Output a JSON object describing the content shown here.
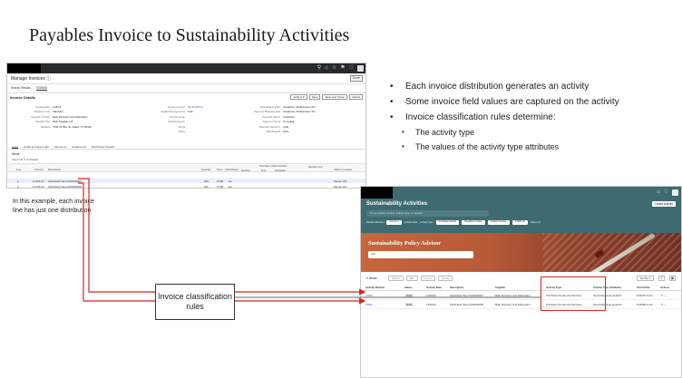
{
  "slide": {
    "title": "Payables Invoice to Sustainability Activities",
    "note": "In this example, each invoice line has just one distribution",
    "rules_box": "Invoice classification rules"
  },
  "bullets": {
    "level1": [
      "Each invoice distribution generates an activity",
      "Some invoice field values are captured on the activity",
      "Invoice classification rules determine:"
    ],
    "level2": [
      "The activity type",
      "The values of the activity type attributes"
    ]
  },
  "manage_invoices": {
    "title": "Manage Invoices ⓘ",
    "done": "Done",
    "tabs": [
      "Search Results",
      "3156616"
    ],
    "section_title": "Invoice Details",
    "actions": [
      "Actions ▾",
      "Save",
      "Save and Close",
      "Cancel"
    ],
    "fields_col1": [
      {
        "label": "Invoice Date",
        "value": "11/3/24"
      },
      {
        "label": "Business Unit",
        "value": "Standard"
      },
      {
        "label": "Supplier or Party",
        "value": "Main Extrusion and Fabrication"
      },
      {
        "label": "Supplier Site",
        "value": "Main Supplies US"
      },
      {
        "label": "Address",
        "value": "7545 JS Pike St. Dallas, TX 00115"
      }
    ],
    "fields_col2": [
      {
        "label": "Invoice Amount",
        "value": "US 10,232.11"
      },
      {
        "label": "Applied Prepayments",
        "value": "0.00"
      },
      {
        "label": "Invoice Group",
        "value": ""
      },
      {
        "label": "Unpaid Amount",
        "value": ""
      },
      {
        "label": "Terms",
        "value": ""
      },
      {
        "label": "Notes",
        "value": ""
      }
    ],
    "fields_col3": [
      {
        "label": "Requisitioning BU",
        "value": "Sustainion US Business Unit"
      },
      {
        "label": "Payment Business Unit",
        "value": "Sustainion US Business Unit"
      },
      {
        "label": "Payment Status",
        "value": "Unverified"
      },
      {
        "label": "Payment Terms",
        "value": "Immediate"
      },
      {
        "label": "Payment Currency",
        "value": "USD"
      },
      {
        "label": "Attachments",
        "value": "None"
      }
    ],
    "lines_tabs": [
      "Lines",
      "Holds and Approvals",
      "Payments",
      "Installments",
      "Distribution Details"
    ],
    "lines_label": "Items",
    "view_row": "View ▾   ⊕   ✎   ⊘   Detach",
    "line_headers": [
      "Line",
      "Amount",
      "Description",
      "Quantity",
      "Price",
      "UOM Name",
      "Purchase Order Number",
      "Line",
      "Schedule",
      "Number",
      "Receipt Line",
      "Ship-to Location"
    ],
    "lines": [
      {
        "line": "1",
        "amount": "11,265.14",
        "description": "Fabricated Steel SCHD00007",
        "quantity": "250",
        "price": "37.68",
        "uom": "Ea",
        "ship_to": "Denver HQ"
      },
      {
        "line": "2",
        "amount": "11,265.14",
        "description": "Fabricated Steel SCHD00008",
        "quantity": "250",
        "price": "37.68",
        "uom": "Ea",
        "ship_to": "Denver HQ"
      }
    ]
  },
  "sustainability": {
    "title": "Sustainability Activities",
    "create_button": "Create Activity",
    "search_placeholder": "Try an activity number, activity type, or supplier",
    "filters": [
      "Results Attention",
      "Source ▾",
      "Activity Date",
      "Activity Type",
      "Purchase Goods",
      "Payables Invoice",
      "Activity Number",
      "27625 (2)",
      "Filters (4)"
    ],
    "advisor_title": "Sustainability Policy Advisor",
    "advisor_input": "Ask",
    "item_count": "2 Items",
    "toolbar_buttons": [
      "Submit",
      "Edit",
      "Cancel",
      "Delete"
    ],
    "sort_by": "Sort By ▾",
    "headers": [
      "Activity Number",
      "Status",
      "Activity Date",
      "Description",
      "Supplier",
      "Activity Type",
      "Activity Type Attributes",
      "Total CO2e",
      "Actions"
    ],
    "rows": [
      {
        "number": "13000",
        "status": "Draft",
        "date": "11/30/24",
        "description": "Fabricated Steel SCHD00007",
        "supplier": "Main Extrusion and Fabrication",
        "type": "Purchased Goods and Services",
        "attributes": "Secondary steel products",
        "co2e": "8,94201 tonne",
        "actions": "✎  ⋯"
      },
      {
        "number": "13001",
        "status": "Draft",
        "date": "11/30/24",
        "description": "Fabricated Steel SCHD00008",
        "supplier": "Main Extrusion and Fabrication",
        "type": "Purchased Goods and Services",
        "attributes": "Secondary steel products",
        "co2e": "8,44699 tonne",
        "actions": "✎  ⋯"
      }
    ]
  },
  "colors": {
    "accent_red": "#d22222",
    "teal_header": "#3e6a71",
    "banner": "#b85a38"
  }
}
